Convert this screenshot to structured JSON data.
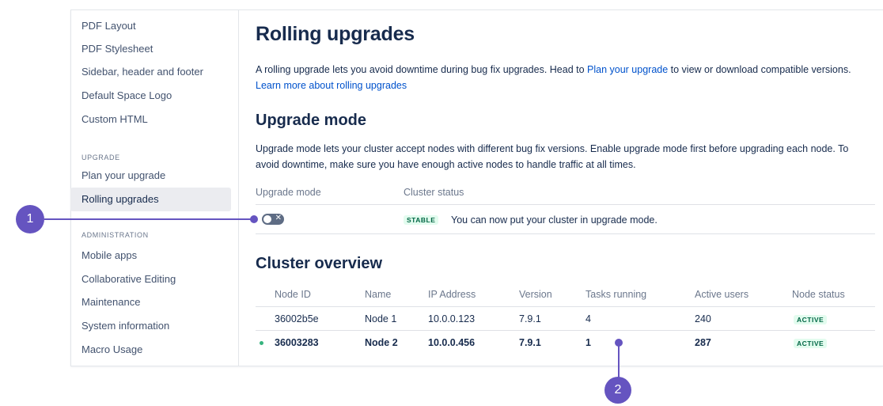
{
  "sidebar": {
    "items_top": [
      {
        "label": "PDF Layout"
      },
      {
        "label": "PDF Stylesheet"
      },
      {
        "label": "Sidebar, header and footer"
      },
      {
        "label": "Default Space Logo"
      },
      {
        "label": "Custom HTML"
      }
    ],
    "upgrade_heading": "UPGRADE",
    "upgrade_items": [
      {
        "label": "Plan your upgrade"
      },
      {
        "label": "Rolling upgrades"
      }
    ],
    "admin_heading": "ADMINISTRATION",
    "admin_items": [
      {
        "label": "Mobile apps"
      },
      {
        "label": "Collaborative Editing"
      },
      {
        "label": "Maintenance"
      },
      {
        "label": "System information"
      },
      {
        "label": "Macro Usage"
      }
    ]
  },
  "page": {
    "title": "Rolling upgrades",
    "intro_1": "A rolling upgrade lets you avoid downtime during bug fix upgrades. Head to ",
    "intro_link_1": "Plan your upgrade",
    "intro_2": " to view or download compatible versions. ",
    "intro_link_2": "Learn more about rolling upgrades"
  },
  "upgrade_mode": {
    "heading": "Upgrade mode",
    "description": "Upgrade mode lets your cluster accept nodes with different bug fix versions. Enable upgrade mode first before upgrading each node. To avoid downtime, make sure you have enough active nodes to handle traffic at all times.",
    "col_mode": "Upgrade mode",
    "col_status": "Cluster status",
    "toggle_on": false,
    "status_badge": "STABLE",
    "status_message": "You can now put your cluster in upgrade mode."
  },
  "cluster": {
    "heading": "Cluster overview",
    "columns": [
      "Node ID",
      "Name",
      "IP Address",
      "Version",
      "Tasks running",
      "Active users",
      "Node status"
    ],
    "rows": [
      {
        "node_id": "36002b5e",
        "name": "Node 1",
        "ip": "10.0.0.123",
        "version": "7.9.1",
        "tasks": "4",
        "users": "240",
        "status": "ACTIVE",
        "current": false
      },
      {
        "node_id": "36003283",
        "name": "Node 2",
        "ip": "10.0.0.456",
        "version": "7.9.1",
        "tasks": "1",
        "users": "287",
        "status": "ACTIVE",
        "current": true
      }
    ]
  },
  "callouts": [
    "1",
    "2"
  ],
  "colors": {
    "callout": "#6554c0",
    "link": "#0052cc",
    "active_bg": "#e3fcef",
    "active_text": "#006644",
    "current_node_dot": "#36b37e"
  }
}
